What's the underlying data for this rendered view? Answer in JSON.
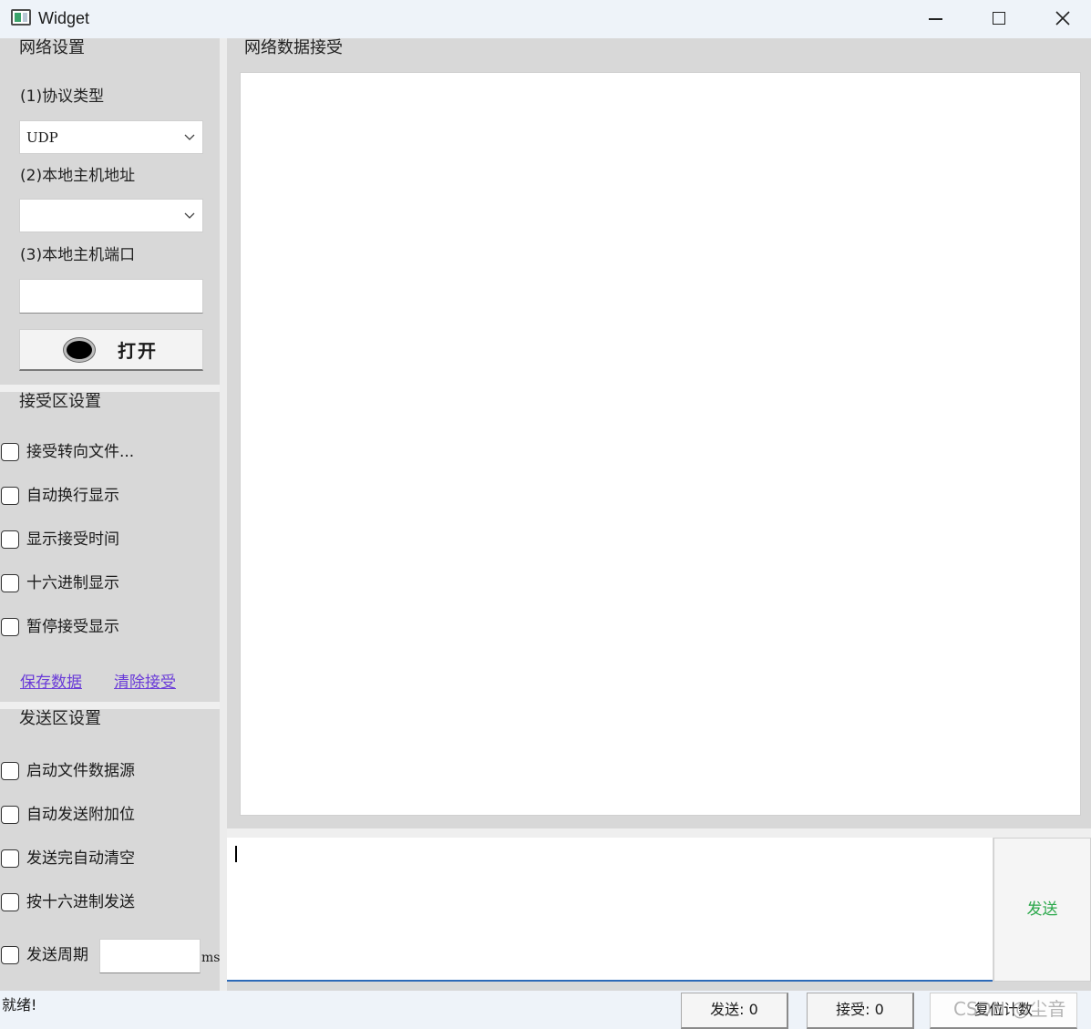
{
  "window": {
    "title": "Widget"
  },
  "network_settings": {
    "title": "网络设置",
    "protocol_label": "(1)协议类型",
    "protocol_value": "UDP",
    "host_label": "(2)本地主机地址",
    "host_value": "",
    "port_label": "(3)本地主机端口",
    "port_value": "",
    "open_button_label": "打开"
  },
  "receive_settings": {
    "title": "接受区设置",
    "options": [
      "接受转向文件...",
      "自动换行显示",
      "显示接受时间",
      "十六进制显示",
      "暂停接受显示"
    ],
    "save_link": "保存数据",
    "clear_link": "清除接受"
  },
  "send_settings": {
    "title": "发送区设置",
    "options": [
      "启动文件数据源",
      "自动发送附加位",
      "发送完自动清空",
      "按十六进制发送"
    ],
    "period_label": "发送周期",
    "period_value": "",
    "period_unit": "ms"
  },
  "receive_panel": {
    "title": "网络数据接受"
  },
  "send_panel": {
    "send_button_label": "发送"
  },
  "status_bar": {
    "status_text": "就绪!",
    "sent_counter": "发送: 0",
    "received_counter": "接受: 0",
    "reset_button_label": "复位计数",
    "watermark": "CSDN @尘音"
  },
  "colors": {
    "send_button_text": "#2aa84a",
    "link": "#6a3bd8",
    "input_focus_underline": "#2d6ab8"
  }
}
